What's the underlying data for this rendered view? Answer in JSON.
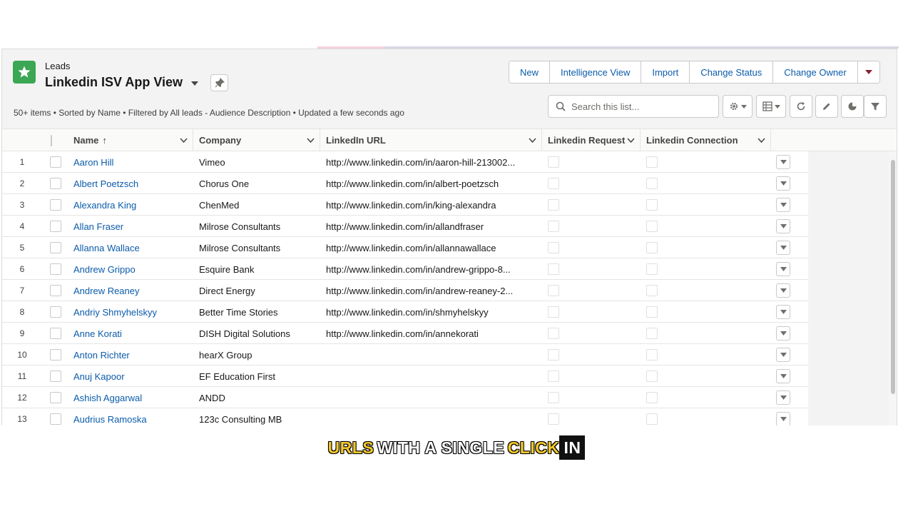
{
  "header": {
    "object_label": "Leads",
    "list_title": "Linkedin ISV App View",
    "meta": "50+ items • Sorted by Name • Filtered by All leads - Audience Description • Updated a few seconds ago",
    "buttons": [
      "New",
      "Intelligence View",
      "Import",
      "Change Status",
      "Change Owner"
    ],
    "search_placeholder": "Search this list...",
    "accent_color": "#3ba755"
  },
  "table": {
    "columns": [
      "Name",
      "Company",
      "LinkedIn URL",
      "Linkedin Request",
      "Linkedin Connection"
    ],
    "sort_indicator": "↑",
    "rows": [
      {
        "n": "1",
        "name": "Aaron Hill",
        "company": "Vimeo",
        "url": "http://www.linkedin.com/in/aaron-hill-213002..."
      },
      {
        "n": "2",
        "name": "Albert Poetzsch",
        "company": "Chorus One",
        "url": "http://www.linkedin.com/in/albert-poetzsch"
      },
      {
        "n": "3",
        "name": "Alexandra King",
        "company": "ChenMed",
        "url": "http://www.linkedin.com/in/king-alexandra"
      },
      {
        "n": "4",
        "name": "Allan Fraser",
        "company": "Milrose Consultants",
        "url": "http://www.linkedin.com/in/allandfraser"
      },
      {
        "n": "5",
        "name": "Allanna Wallace",
        "company": "Milrose Consultants",
        "url": "http://www.linkedin.com/in/allannawallace"
      },
      {
        "n": "6",
        "name": "Andrew Grippo",
        "company": "Esquire Bank",
        "url": "http://www.linkedin.com/in/andrew-grippo-8..."
      },
      {
        "n": "7",
        "name": "Andrew Reaney",
        "company": "Direct Energy",
        "url": "http://www.linkedin.com/in/andrew-reaney-2..."
      },
      {
        "n": "8",
        "name": "Andriy Shmyhelskyy",
        "company": "Better Time Stories",
        "url": "http://www.linkedin.com/in/shmyhelskyy"
      },
      {
        "n": "9",
        "name": "Anne Korati",
        "company": "DISH Digital Solutions",
        "url": "http://www.linkedin.com/in/annekorati"
      },
      {
        "n": "10",
        "name": "Anton Richter",
        "company": "hearX Group",
        "url": ""
      },
      {
        "n": "11",
        "name": "Anuj Kapoor",
        "company": "EF Education First",
        "url": ""
      },
      {
        "n": "12",
        "name": "Ashish Aggarwal",
        "company": "ANDD",
        "url": ""
      },
      {
        "n": "13",
        "name": "Audrius Ramoska",
        "company": "123c Consulting MB",
        "url": ""
      }
    ]
  },
  "caption": {
    "w1": "URLS",
    "w2": "WITH A SINGLE",
    "w3": "CLICK",
    "w4": "IN"
  }
}
